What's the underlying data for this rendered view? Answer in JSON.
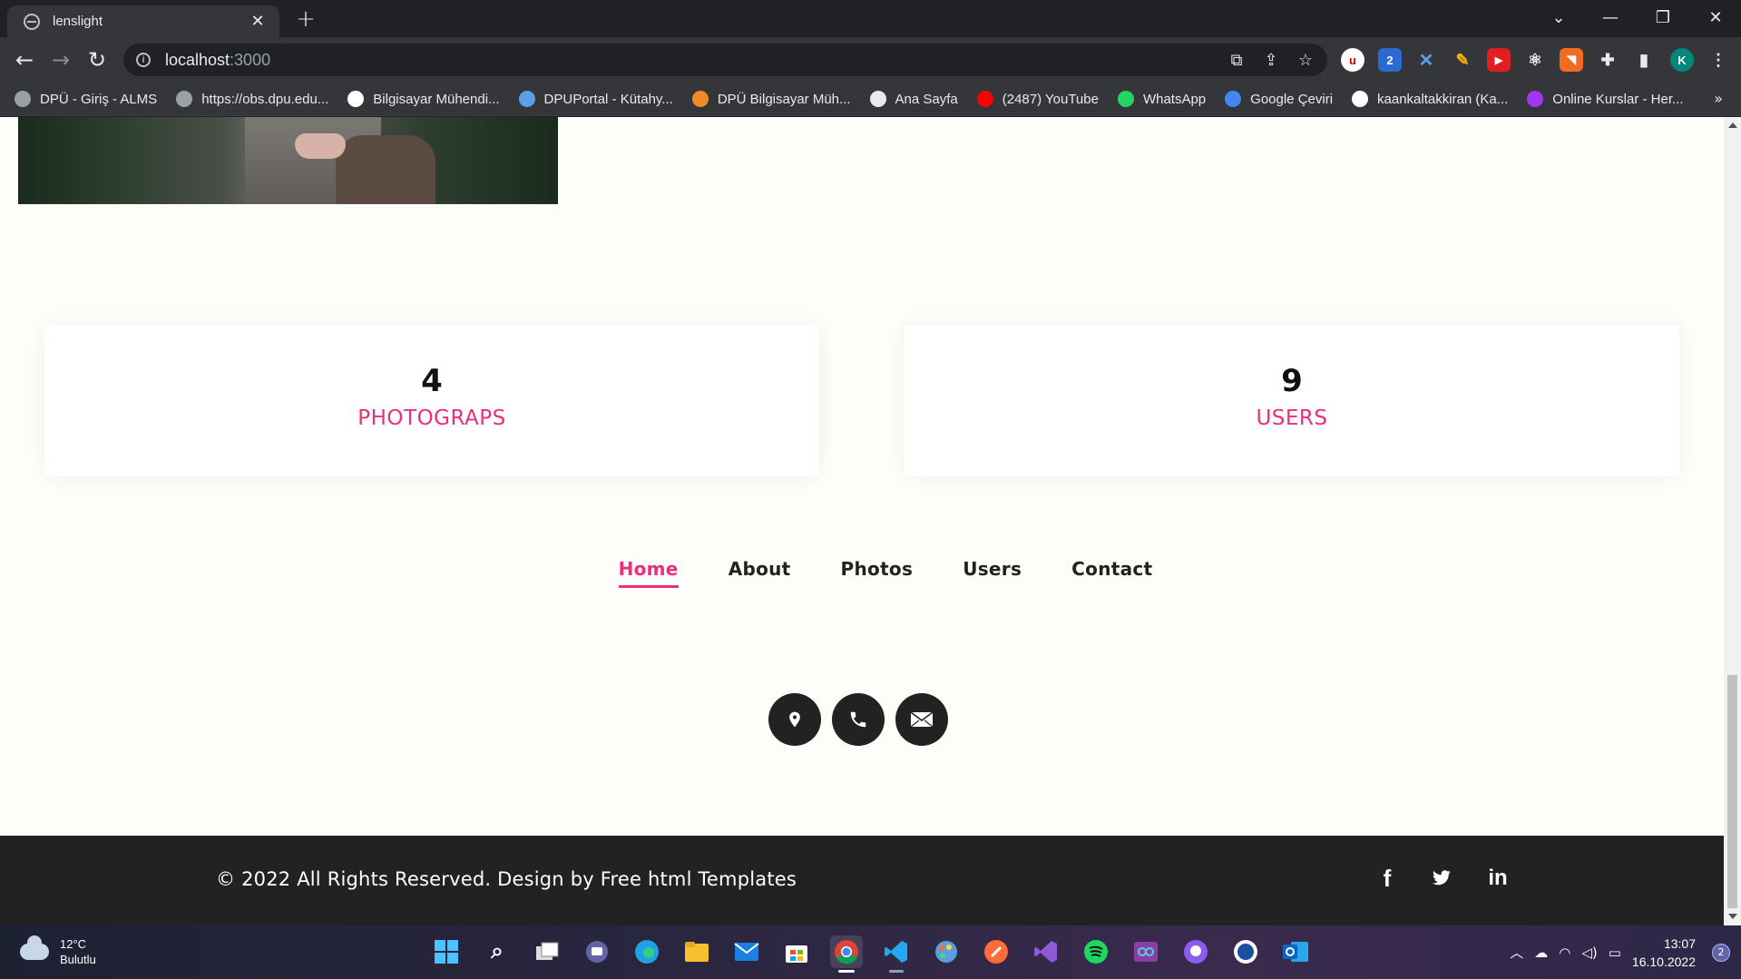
{
  "browser": {
    "tab_title": "lenslight",
    "url_host": "localhost",
    "url_port": ":3000",
    "profile_initial": "K"
  },
  "bookmarks": [
    {
      "label": "DPÜ - Giriş - ALMS",
      "icon": "globe-icon",
      "color": "#9aa0a6"
    },
    {
      "label": "https://obs.dpu.edu...",
      "icon": "globe-icon",
      "color": "#9aa0a6"
    },
    {
      "label": "Bilgisayar Mühendi...",
      "icon": "dpu-logo-icon",
      "color": "#ffffff"
    },
    {
      "label": "DPUPortal - Kütahy...",
      "icon": "portal-icon",
      "color": "#5aa0e6"
    },
    {
      "label": "DPÜ Bilgisayar Müh...",
      "icon": "dpu-orange-icon",
      "color": "#f08a24"
    },
    {
      "label": "Ana Sayfa",
      "icon": "btk-icon",
      "color": "#e8eaed"
    },
    {
      "label": "(2487) YouTube",
      "icon": "youtube-icon",
      "color": "#ff0000"
    },
    {
      "label": "WhatsApp",
      "icon": "whatsapp-icon",
      "color": "#25d366"
    },
    {
      "label": "Google Çeviri",
      "icon": "google-translate-icon",
      "color": "#4285f4"
    },
    {
      "label": "kaankaltakkiran (Ka...",
      "icon": "github-icon",
      "color": "#ffffff"
    },
    {
      "label": "Online Kurslar - Her...",
      "icon": "udemy-icon",
      "color": "#a435f0"
    }
  ],
  "page": {
    "stats": [
      {
        "value": "4",
        "label": "PHOTOGRAPS"
      },
      {
        "value": "9",
        "label": "USERS"
      }
    ],
    "nav": [
      {
        "label": "Home",
        "active": true
      },
      {
        "label": "About",
        "active": false
      },
      {
        "label": "Photos",
        "active": false
      },
      {
        "label": "Users",
        "active": false
      },
      {
        "label": "Contact",
        "active": false
      }
    ],
    "contact_icons": [
      "location-icon",
      "phone-icon",
      "mail-icon"
    ],
    "copyright": "© 2022 All Rights Reserved. Design by Free html Templates",
    "social": [
      "facebook-icon",
      "twitter-icon",
      "linkedin-icon"
    ],
    "accent_color": "#e8307a"
  },
  "taskbar": {
    "weather_temp": "12°C",
    "weather_desc": "Bulutlu",
    "time": "13:07",
    "date": "16.10.2022",
    "notifications": "2"
  }
}
